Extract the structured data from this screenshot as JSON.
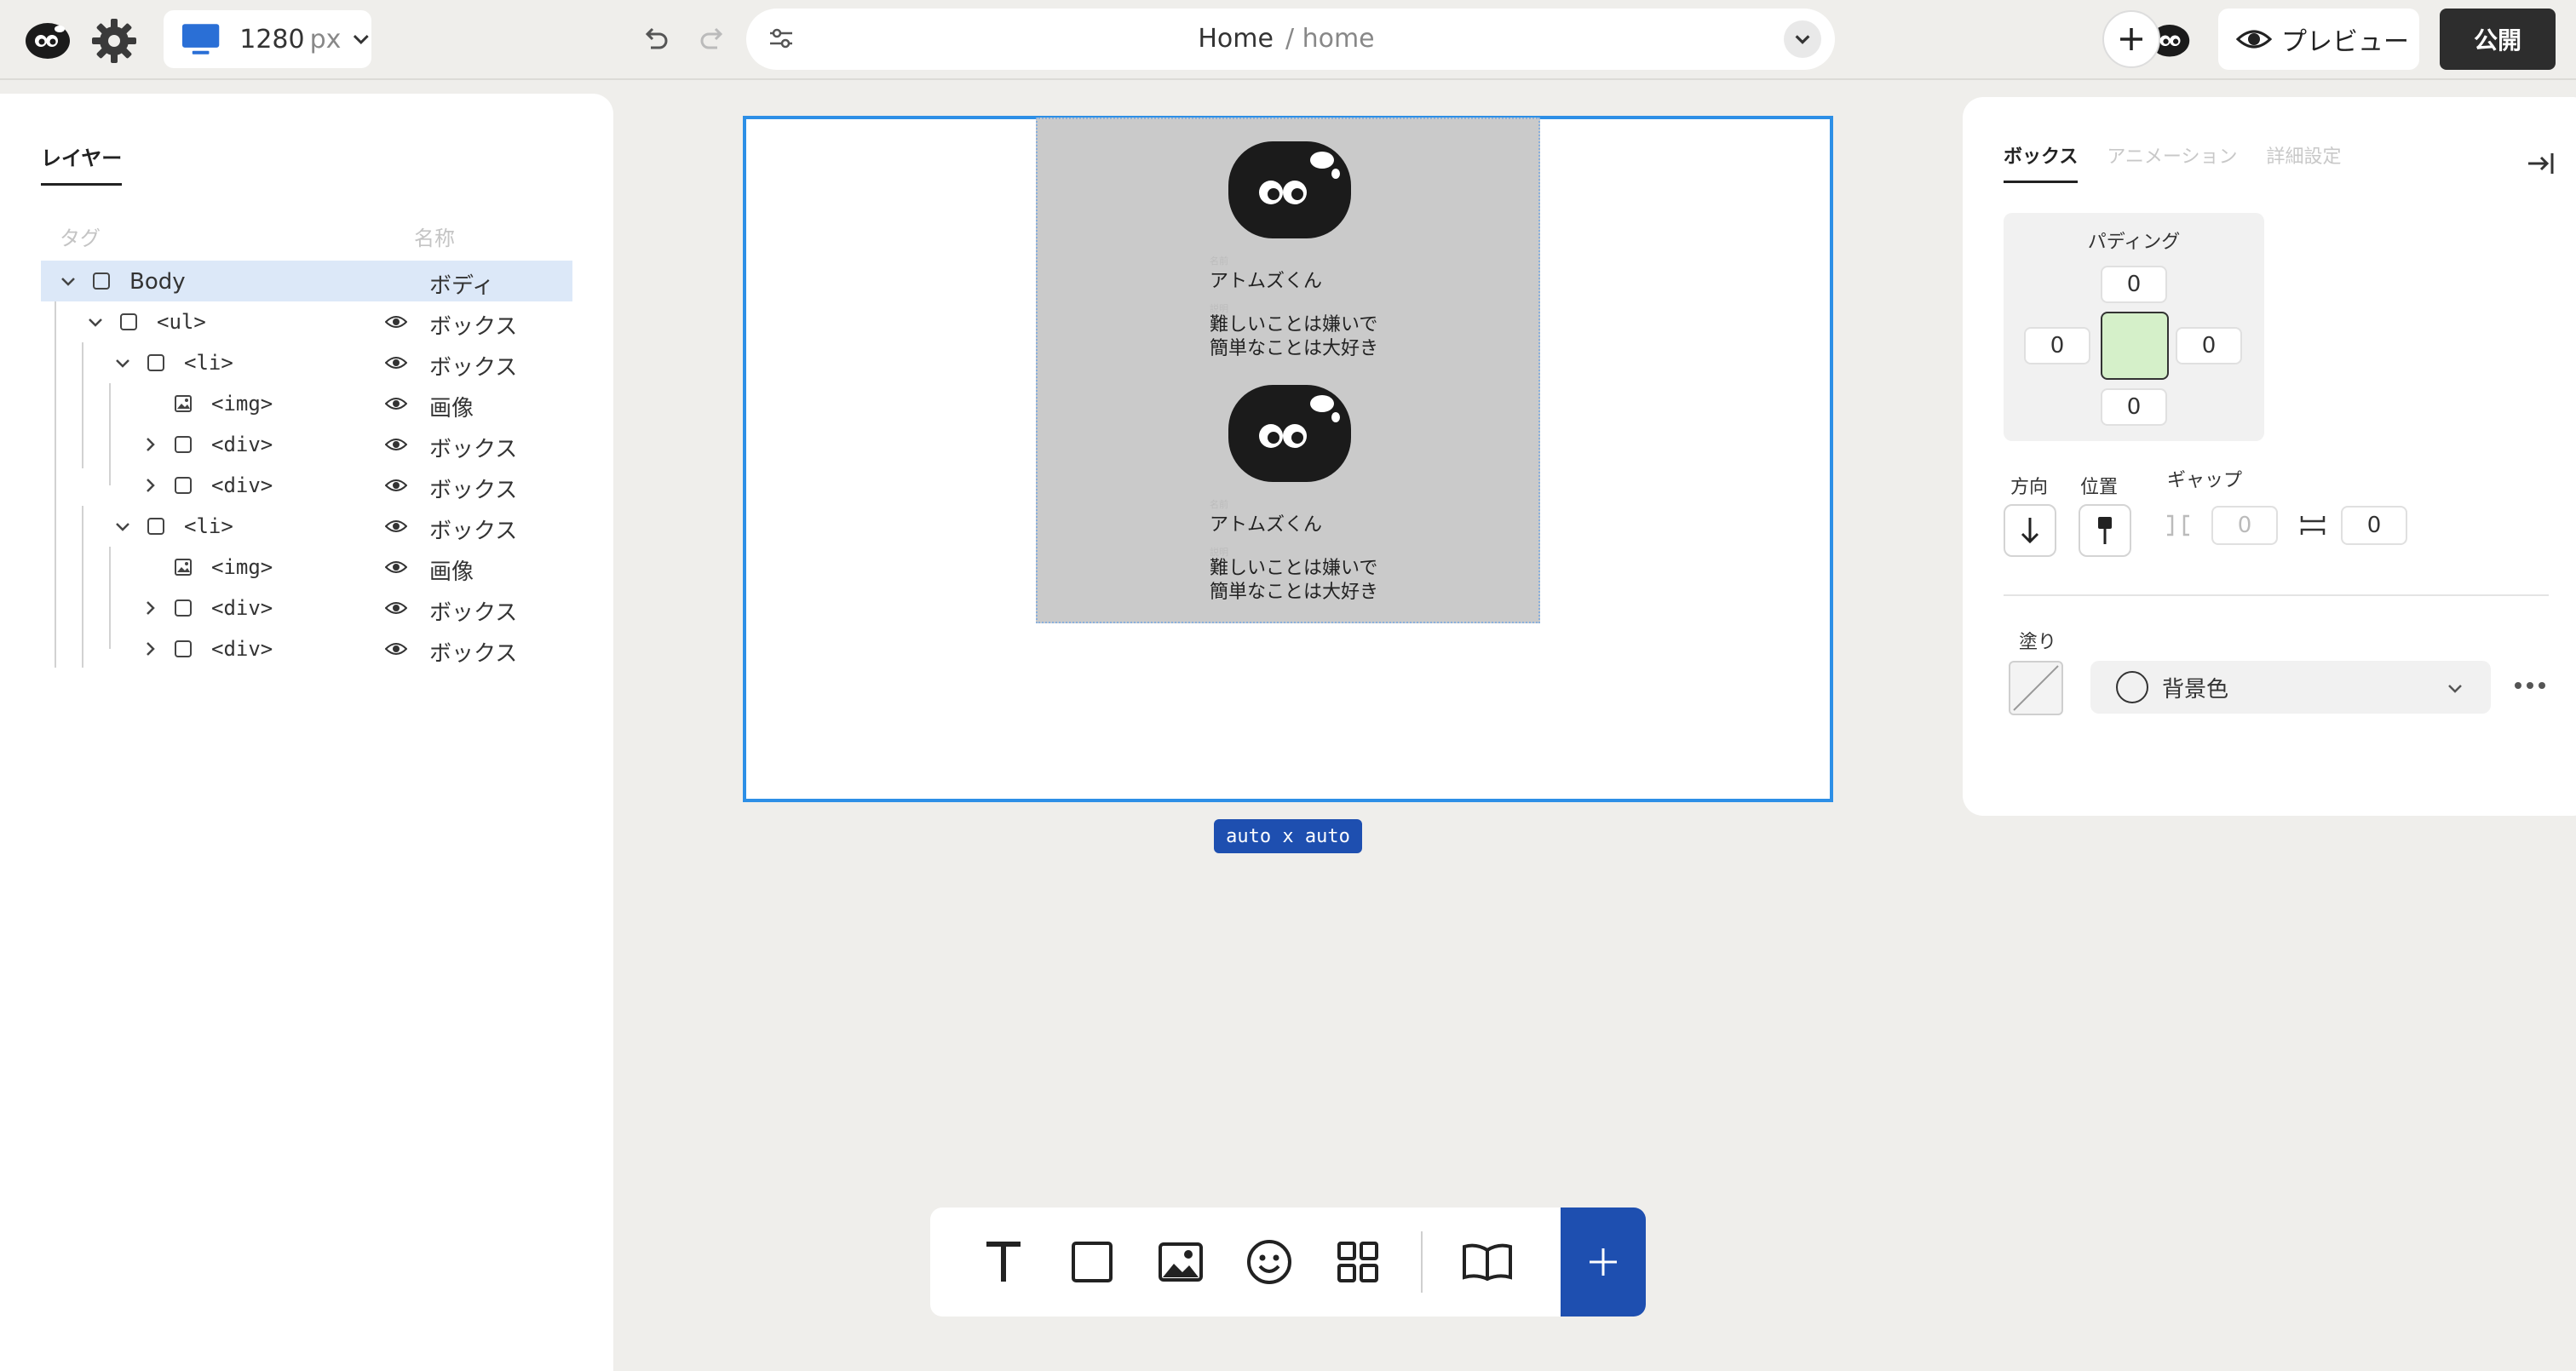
{
  "topbar": {
    "device_width": "1280",
    "device_unit": "px",
    "page_name": "Home",
    "page_path": "/ home",
    "preview_label": "プレビュー",
    "publish_label": "公開"
  },
  "layers": {
    "tab_label": "レイヤー",
    "col_tag": "タグ",
    "col_name": "名称",
    "rows": [
      {
        "tag": "Body",
        "name": "ボディ"
      },
      {
        "tag": "<ul>",
        "name": "ボックス"
      },
      {
        "tag": "<li>",
        "name": "ボックス"
      },
      {
        "tag": "<img>",
        "name": "画像"
      },
      {
        "tag": "<div>",
        "name": "ボックス"
      },
      {
        "tag": "<div>",
        "name": "ボックス"
      },
      {
        "tag": "<li>",
        "name": "ボックス"
      },
      {
        "tag": "<img>",
        "name": "画像"
      },
      {
        "tag": "<div>",
        "name": "ボックス"
      },
      {
        "tag": "<div>",
        "name": "ボックス"
      }
    ]
  },
  "canvas": {
    "cards": [
      {
        "name": "アトムズくん",
        "desc_line1": "難しいことは嫌いで",
        "desc_line2": "簡単なことは大好き"
      },
      {
        "name": "アトムズくん",
        "desc_line1": "難しいことは嫌いで",
        "desc_line2": "簡単なことは大好き"
      }
    ],
    "size_badge": "auto x auto"
  },
  "properties": {
    "tabs": [
      "ボックス",
      "アニメーション",
      "詳細設定"
    ],
    "padding_label": "パディング",
    "padding": {
      "top": "0",
      "left": "0",
      "right": "0",
      "bottom": "0"
    },
    "direction_label": "方向",
    "position_label": "位置",
    "gap_label": "ギャップ",
    "gap_row": "0",
    "gap_column": "0",
    "fill_label": "塗り",
    "fill_value": "背景色"
  },
  "colors": {
    "accent": "#2d8fe6",
    "primary_button": "#1e4fb0",
    "selected_row": "#dce8f8",
    "canvas_bg": "#efeeeb",
    "content_bg": "#cacaca"
  },
  "icons": {
    "toolbar": [
      "text-icon",
      "box-icon",
      "image-icon",
      "emoji-icon",
      "grid-icon",
      "book-icon",
      "plus-icon"
    ]
  }
}
